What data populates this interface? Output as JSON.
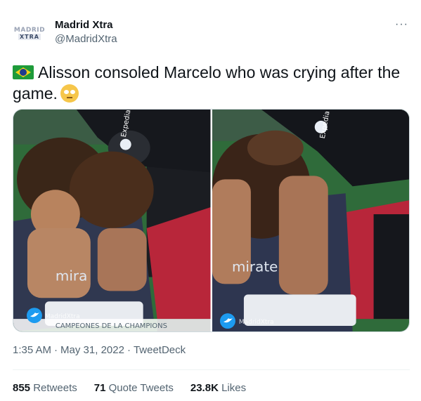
{
  "author": {
    "avatar_text_top": "MADRID",
    "avatar_text_bottom": "XTRA",
    "name": "Madrid Xtra",
    "handle": "@MadridXtra"
  },
  "menu": {
    "more_label": "···"
  },
  "tweet": {
    "text": "Alisson consoled Marcelo who was crying after the game.",
    "flag_emoji": "brazil-flag-icon",
    "trailing_emoji": "face-holding-back-tears-icon"
  },
  "media": {
    "photos": [
      {
        "watermark": "MadridXtra",
        "jersey_text": "mira",
        "sponsor_text": "Expedia",
        "ticker": "CAMPEONES DE LA CHAMPIONS"
      },
      {
        "watermark": "MadridXtra",
        "jersey_text": "mirate",
        "sponsor_text": "Expedia"
      }
    ]
  },
  "meta": {
    "time": "1:35 AM",
    "date": "May 31, 2022",
    "source": "TweetDeck"
  },
  "stats": [
    {
      "count": "855",
      "label": "Retweets"
    },
    {
      "count": "71",
      "label": "Quote Tweets"
    },
    {
      "count": "23.8K",
      "label": "Likes"
    }
  ],
  "colors": {
    "text_primary": "#0f1419",
    "text_secondary": "#536471",
    "twitter_blue": "#1d9bf0"
  }
}
